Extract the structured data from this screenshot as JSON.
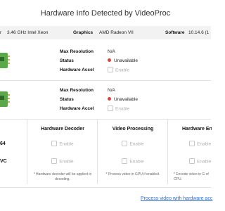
{
  "window": {
    "title": "Hardware Info Detected by VideoProc"
  },
  "hardware": {
    "cpu_label_fragment": "r",
    "cpu_value": "3.46 GHz Intel Xeon",
    "graphics_label": "Graphics",
    "graphics_value": "AMD Radeon VII",
    "software_label": "Software",
    "software_value": "10.14.6 (1"
  },
  "gpu_cards": [
    {
      "max_resolution_label": "Max Resolution",
      "max_resolution_value": "N/A",
      "status_label": "Status",
      "status_value": "Unavailable",
      "accel_label": "Hardware Accel",
      "accel_option": "Enable",
      "status_color": "#e0413c"
    },
    {
      "max_resolution_label": "Max Resolution",
      "max_resolution_value": "N/A",
      "status_label": "Status",
      "status_value": "Unavailable",
      "accel_label": "Hardware Accel",
      "accel_option": "Enable",
      "status_color": "#e0413c"
    }
  ],
  "codecs": {
    "row1_fragment": "64",
    "row2_fragment": "VC"
  },
  "columns": [
    {
      "title": "Hardware Decoder",
      "option1": "Enable",
      "option2": "Enable",
      "note": "* Hardware decoder will be applied in decoding."
    },
    {
      "title": "Video Processing",
      "option1": "Enable",
      "option2": "Enable",
      "note": "* Process video in GPU if enabled."
    },
    {
      "title": "Hardware Enc",
      "option1": "Enable",
      "option2": "Enable",
      "note": "* Encode video in G of CPU."
    }
  ],
  "footer": {
    "link_text": "Process video with hardware acc"
  },
  "colors": {
    "link": "#2e6fd8",
    "unavailable": "#e0413c",
    "gpu_icon": "#5aa84a"
  }
}
